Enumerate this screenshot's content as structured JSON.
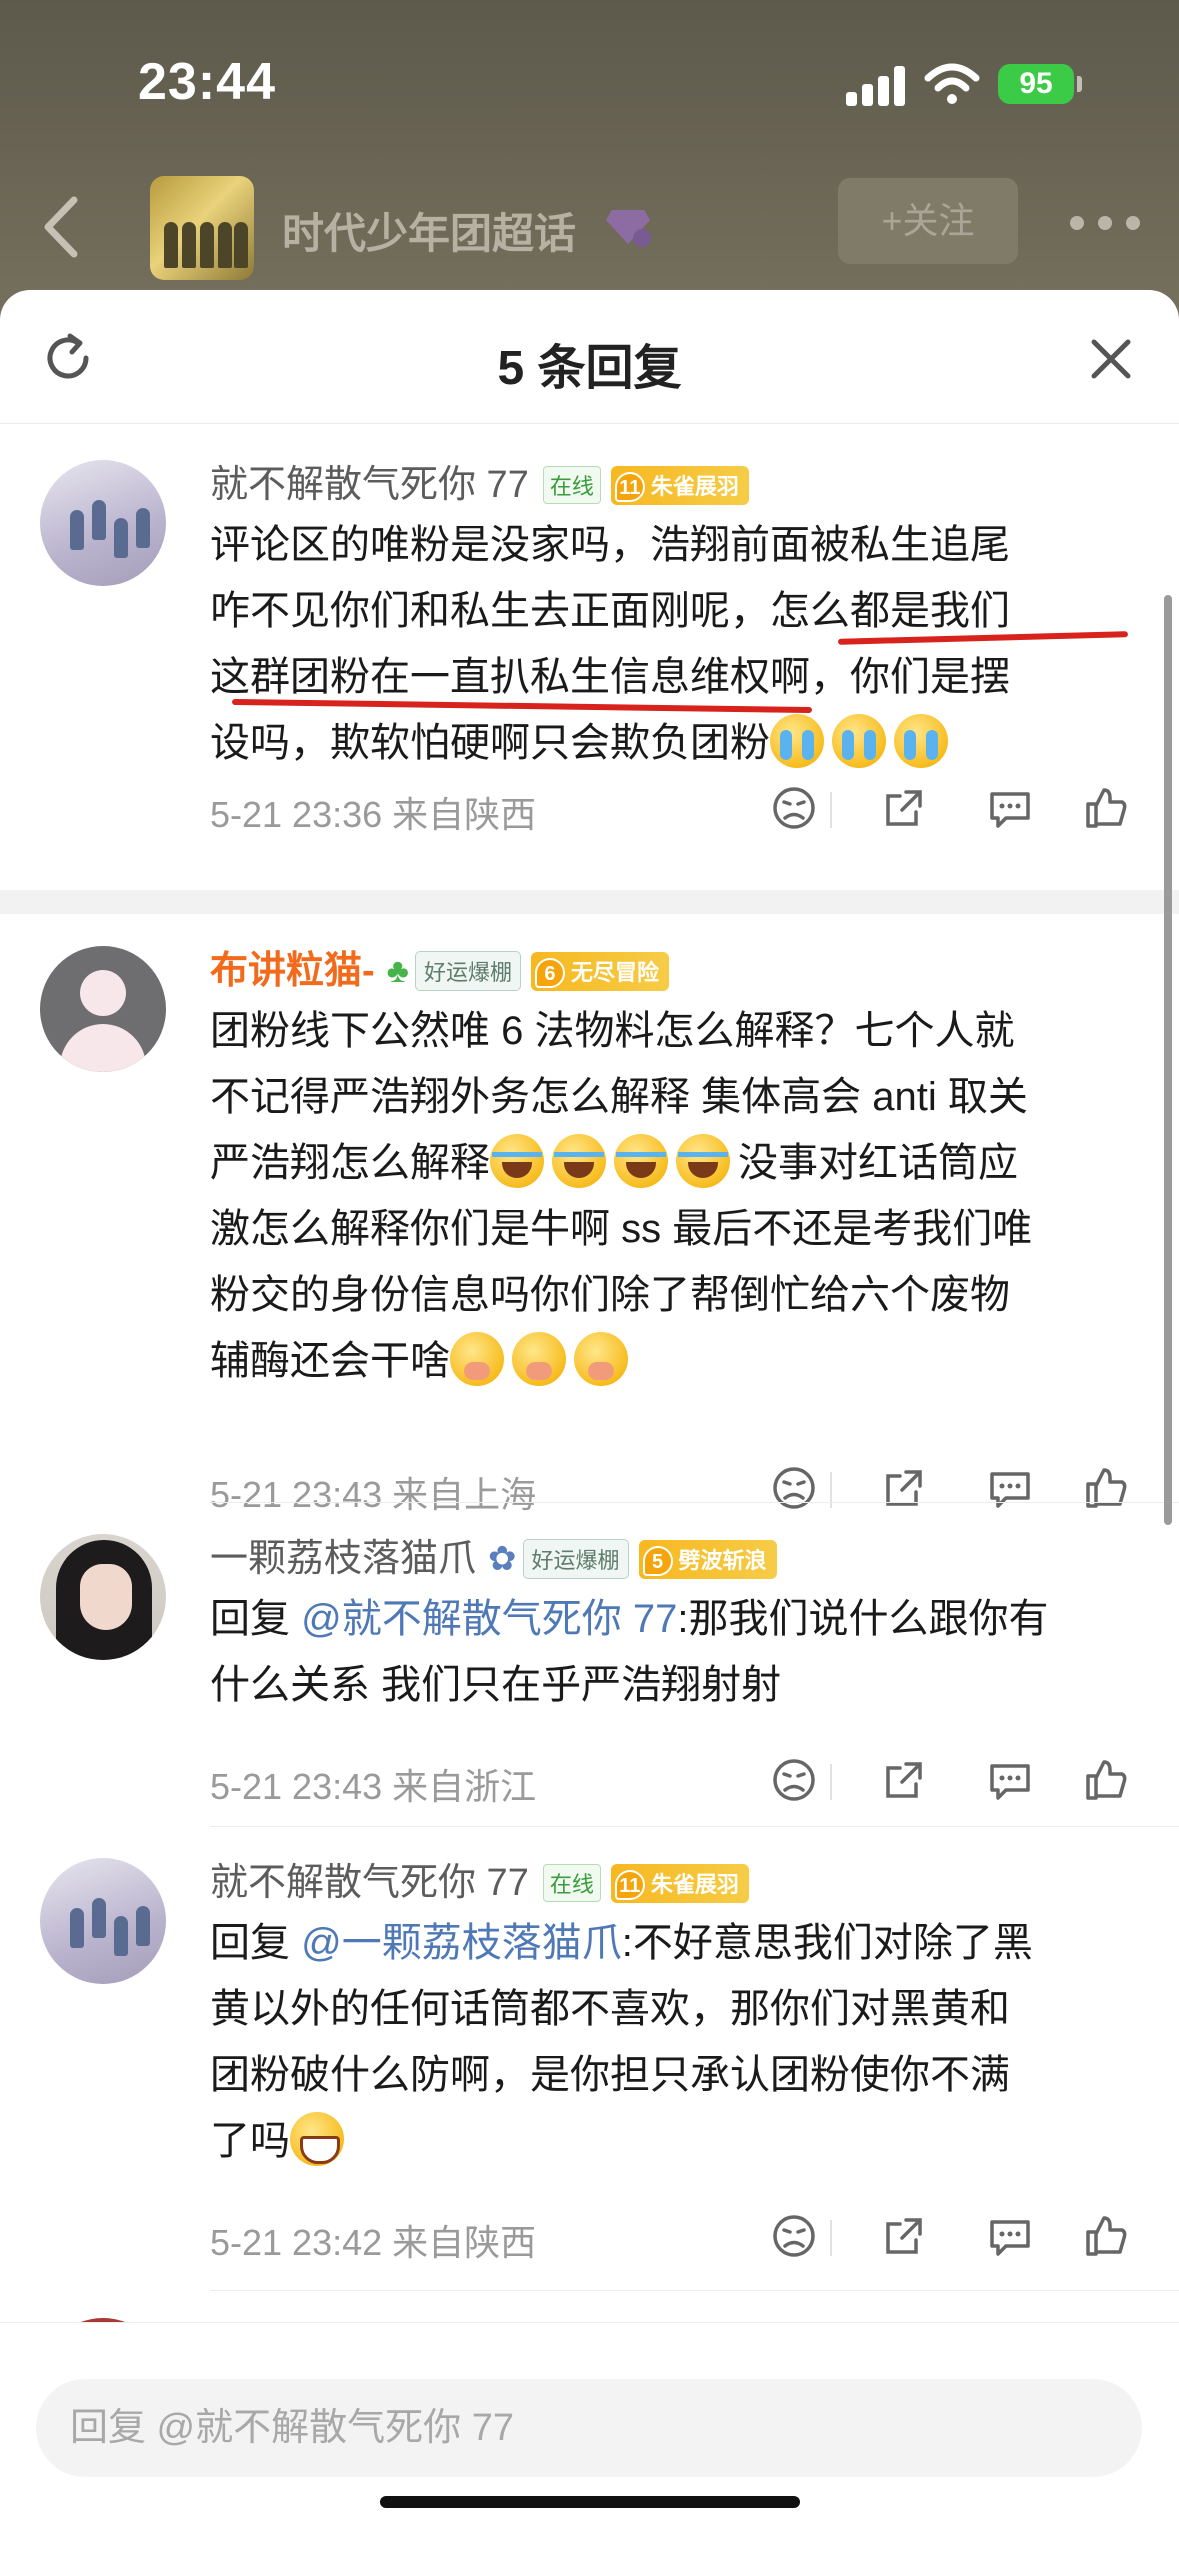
{
  "status_bar": {
    "time": "23:44",
    "battery": "95"
  },
  "nav": {
    "topic_title": "时代少年团超话",
    "follow_label": "+关注"
  },
  "sheet": {
    "title": "5 条回复",
    "compose_placeholder": "回复 @就不解散气死你 77"
  },
  "icons": [
    "signal-icon",
    "wifi-icon",
    "battery-icon",
    "back-icon",
    "gem-icon",
    "more-icon",
    "refresh-icon",
    "close-icon",
    "dislike-icon",
    "share-icon",
    "comment-icon",
    "like-icon",
    "clover-icon"
  ],
  "colors": {
    "username_highlight": "#f26a1b",
    "mention": "#4f79b6",
    "underline": "#d8221c",
    "online_badge": "#3a9c3b",
    "level_badge": "#f7b820"
  },
  "comments": [
    {
      "username": "就不解散气死你 77",
      "online": "在线",
      "level": "11",
      "level_title": "朱雀展羽",
      "lines": [
        "评论区的唯粉是没家吗，浩翔前面被私生追尾",
        "咋不见你们和私生去正面刚呢，怎么都是我们",
        "这群团粉在一直扒私生信息维权啊，你们是摆",
        "设吗，欺软怕硬啊只会欺负团粉"
      ],
      "date": "5-21 23:36",
      "location": "来自陕西"
    },
    {
      "username": "布讲粒猫-",
      "lucky": "好运爆棚",
      "level": "6",
      "level_title": "无尽冒险",
      "lines": [
        "团粉线下公然唯 6 法物料怎么解释？七个人就",
        "不记得严浩翔外务怎么解释 集体高会 anti 取关",
        "严浩翔怎么解释",
        "没事对红话筒应",
        "激怎么解释你们是牛啊 ss 最后不还是考我们唯",
        "粉交的身份信息吗你们除了帮倒忙给六个废物",
        "辅酶还会干啥"
      ],
      "date": "5-21 23:43",
      "location": "来自上海"
    },
    {
      "username": "一颗荔枝落猫爪",
      "lucky": "好运爆棚",
      "level": "5",
      "level_title": "劈波斩浪",
      "reply_prefix": "回复",
      "mention": "@就不解散气死你 77",
      "lines": [
        ":那我们说什么跟你有",
        "什么关系 我们只在乎严浩翔射射"
      ],
      "date": "5-21 23:43",
      "location": "来自浙江"
    },
    {
      "username": "就不解散气死你 77",
      "online": "在线",
      "level": "11",
      "level_title": "朱雀展羽",
      "reply_prefix": "回复",
      "mention": "@一颗荔枝落猫爪",
      "lines": [
        ":不好意思我们对除了黑",
        "黄以外的任何话筒都不喜欢，那你们对黑黄和",
        "团粉破什么防啊，是你担只承认团粉使你不满",
        "了吗"
      ],
      "date": "5-21 23:42",
      "location": "来自陕西"
    }
  ]
}
